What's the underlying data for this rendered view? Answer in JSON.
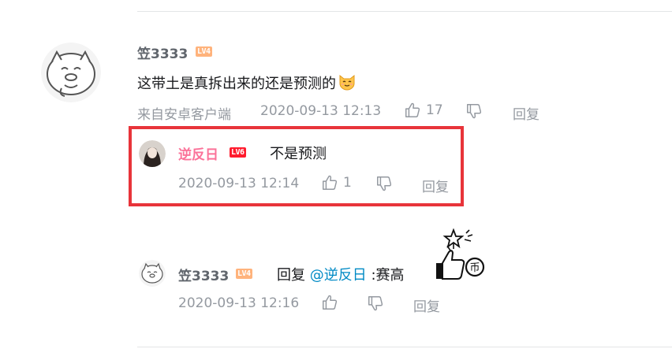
{
  "comment": {
    "username": "笠3333",
    "level": "LV4",
    "text": "这带土是真拆出来的还是预测的",
    "source": "来自安卓客户端",
    "time": "2020-09-13 12:13",
    "likes": "17",
    "reply_label": "回复",
    "emoji": "cat-emoji"
  },
  "replies": [
    {
      "username": "逆反日",
      "level": "LV6",
      "text": "不是预测",
      "time": "2020-09-13 12:14",
      "likes": "1",
      "reply_label": "回复"
    },
    {
      "username": "笠3333",
      "level": "LV4",
      "reply_prefix": "回复",
      "mention": "@逆反日",
      "text": ":赛高",
      "time": "2020-09-13 12:16",
      "reply_label": "回复",
      "sticker": "thumbs-up-coin-sticker"
    }
  ],
  "colors": {
    "highlight_border": "#e8343a",
    "vip_name": "#fb7299",
    "link": "#008ac5",
    "meta": "#9499a0"
  }
}
